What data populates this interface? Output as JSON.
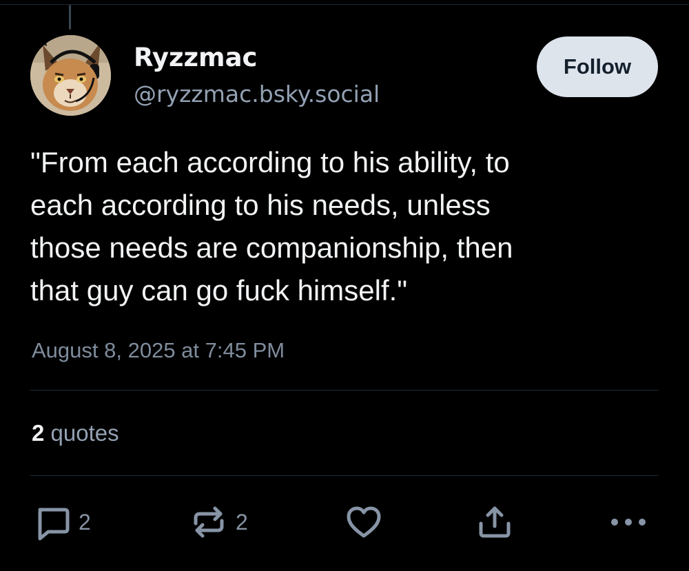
{
  "post": {
    "author": {
      "display_name": "Ryzzmac",
      "handle": "@ryzzmac.bsky.social",
      "avatar_icon": "caracal-avatar"
    },
    "follow_label": "Follow",
    "text": "\"From each according to his ability, to\neach according to his needs, unless\nthose needs are companionship, then\nthat guy can go fuck himself.\"",
    "timestamp": "August 8, 2025 at 7:45 PM",
    "stats": {
      "quotes_count": "2",
      "quotes_label": "quotes"
    },
    "actions": {
      "reply": {
        "icon": "reply-icon",
        "count": "2"
      },
      "repost": {
        "icon": "repost-icon",
        "count": "2"
      },
      "like": {
        "icon": "heart-icon"
      },
      "share": {
        "icon": "share-icon"
      },
      "more": {
        "icon": "more-icon"
      }
    }
  },
  "colors": {
    "background": "#000000",
    "text_primary": "#f1f3f5",
    "text_secondary": "#93a1b3",
    "follow_bg": "#dde4ec",
    "divider": "#1e2936"
  }
}
